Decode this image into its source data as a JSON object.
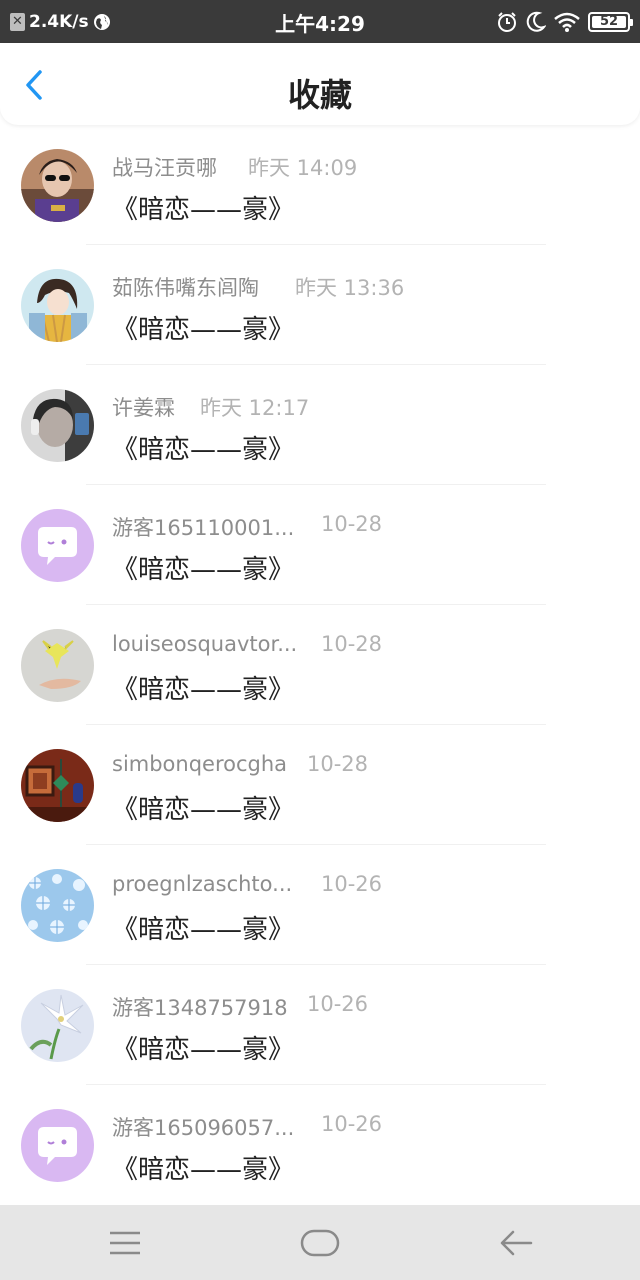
{
  "status_bar": {
    "speed": "2.4K/s",
    "time": "上午4:29",
    "battery": "52"
  },
  "header": {
    "title": "收藏"
  },
  "items": [
    {
      "name": "战马汪贡哪",
      "time": "昨天 14:09",
      "title": "《暗恋——豪》"
    },
    {
      "name": "茹陈伟嘴东闾陶",
      "time": "昨天 13:36",
      "title": "《暗恋——豪》"
    },
    {
      "name": "许姜霖",
      "time": "昨天 12:17",
      "title": "《暗恋——豪》"
    },
    {
      "name": "游客165110001...",
      "time": "10-28",
      "title": "《暗恋——豪》"
    },
    {
      "name": "louiseosquavtor...",
      "time": "10-28",
      "title": "《暗恋——豪》"
    },
    {
      "name": "simbonqerocgha",
      "time": "10-28",
      "title": "《暗恋——豪》"
    },
    {
      "name": "proegnlzaschto...",
      "time": "10-26",
      "title": "《暗恋——豪》"
    },
    {
      "name": "游客1348757918",
      "time": "10-26",
      "title": "《暗恋——豪》"
    },
    {
      "name": "游客165096057...",
      "time": "10-26",
      "title": "《暗恋——豪》"
    }
  ],
  "colors": {
    "accent": "#2196f3",
    "chat_avatar_bg": "#d9b8f2",
    "navbar_bg": "#e6e6e6"
  }
}
